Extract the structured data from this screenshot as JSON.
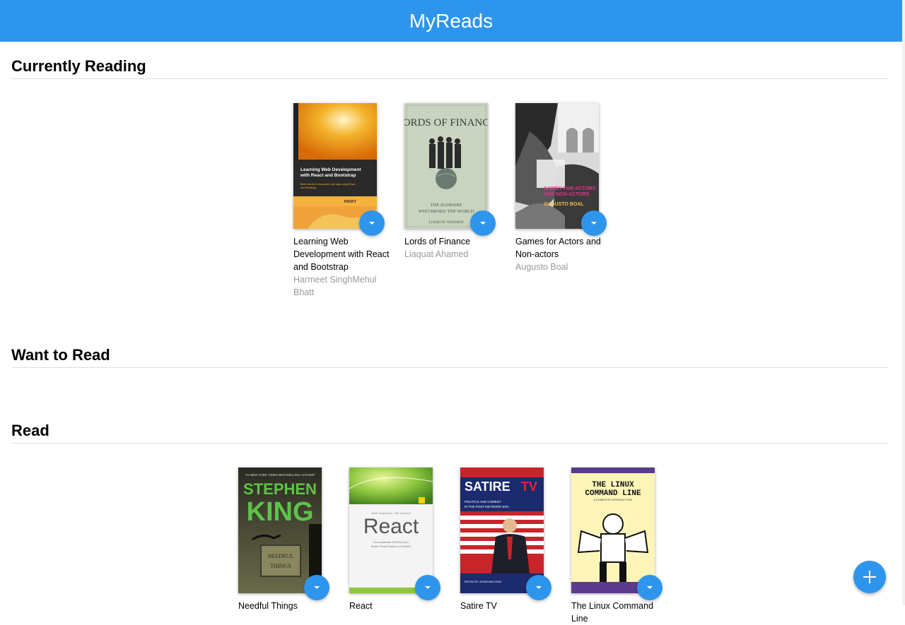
{
  "app": {
    "title": "MyReads"
  },
  "shelves": {
    "currently_reading": {
      "title": "Currently Reading",
      "books": [
        {
          "title": "Learning Web Development with React and Bootstrap",
          "authors": "Harmeet SinghMehul Bhatt",
          "cover_text": "Learning Web Development with React and Bootstrap",
          "cover_subtext": "Build real-time responsive web apps using React and Bootstrap",
          "cover_publisher": "PACKT"
        },
        {
          "title": "Lords of Finance",
          "authors": "Liaquat Ahamed",
          "cover_text": "LORDS OF FINANCE",
          "cover_subtext": "THE BANKERS WHO BROKE THE WORLD",
          "cover_author": "LIAQUAT AHAMED"
        },
        {
          "title": "Games for Actors and Non-actors",
          "authors": "Augusto Boal",
          "cover_text": "GAMES FOR ACTORS AND NON-ACTORS",
          "cover_author": "AUGUSTO BOAL"
        }
      ]
    },
    "want_to_read": {
      "title": "Want to Read",
      "books": []
    },
    "read": {
      "title": "Read",
      "books": [
        {
          "title": "Needful Things",
          "cover_top": "#1 NEW YORK TIMES BESTSELLING AUTHOR",
          "cover_author_first": "STEPHEN",
          "cover_author_last": "KING",
          "cover_text": "NEEDFUL THINGS"
        },
        {
          "title": "React",
          "cover_text": "React",
          "cover_subtext": "Die praktische Einführung in React, React Router und Redux"
        },
        {
          "title": "Satire TV",
          "cover_text_1": "SATIRE",
          "cover_text_2": "TV",
          "cover_subtext": "POLITICS AND COMEDY IN THE POST-NETWORK ERA"
        },
        {
          "title": "The Linux Command Line",
          "cover_text_1": "THE LINUX",
          "cover_text_2": "COMMAND LINE",
          "cover_subtext": "A COMPLETE INTRODUCTION"
        }
      ]
    }
  },
  "colors": {
    "primary": "#2e95ec",
    "author_text": "#999999",
    "divider": "#dedede"
  },
  "icons": {
    "shelf_changer": "caret-down-icon",
    "add": "plus-icon"
  }
}
